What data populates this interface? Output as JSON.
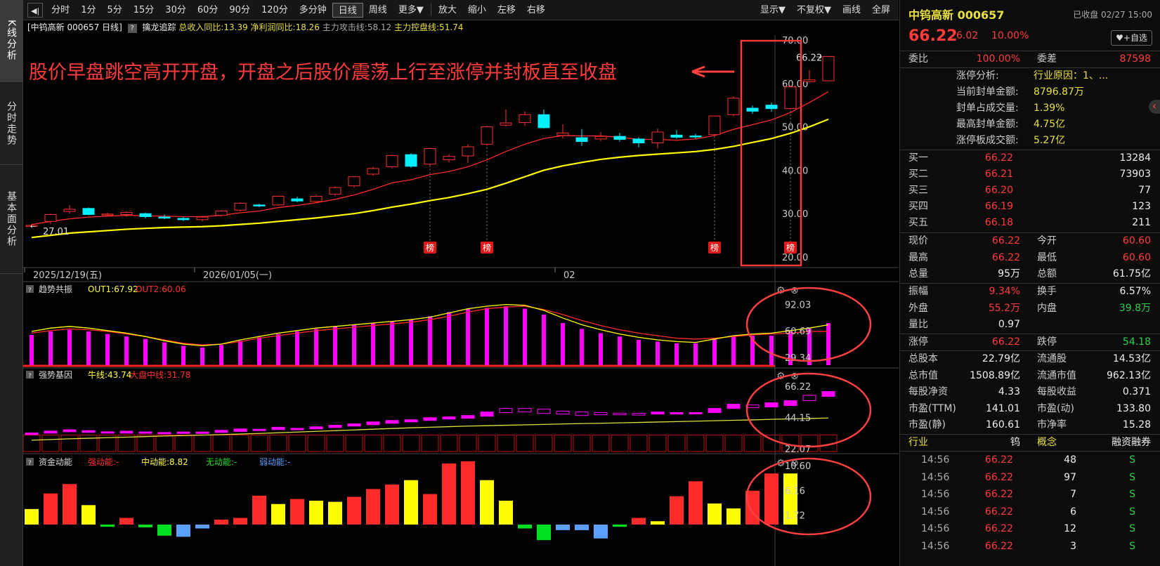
{
  "sidebar": {
    "tabs": [
      {
        "label": "K线分析"
      },
      {
        "label": "分时走势"
      },
      {
        "label": "基本面分析"
      }
    ]
  },
  "toolbar": {
    "nav_icon": "◀|",
    "periods": [
      "分时",
      "1分",
      "5分",
      "15分",
      "30分",
      "60分",
      "90分",
      "120分",
      "多分钟",
      "日线",
      "周线",
      "更多▼"
    ],
    "active": "日线",
    "actions": [
      "放大",
      "缩小",
      "左移",
      "右移"
    ],
    "right": [
      "显示▼",
      "不复权▼",
      "画线",
      "全屏"
    ]
  },
  "infobar": {
    "stock": "[中钨高新 000657 日线]",
    "indicator": "擒龙追踪",
    "v1": "总收入同比:13.39",
    "v2": "净利润同比:18.26",
    "v3": "主力攻击线:58.12",
    "v4": "主力控盘线:51.74"
  },
  "main_chart": {
    "annotation": "股价早盘跳空高开开盘，开盘之后股价震荡上行至涨停并封板直至收盘",
    "price_label": "66.22",
    "low_label": "27.01",
    "dates": [
      "2025/12/19(五)",
      "2026/01/05(一)",
      "02"
    ],
    "bang_label": "榜"
  },
  "panel2": {
    "name": "趋势共振",
    "out1": "OUT1:67.92",
    "out2": "OUT2:60.06",
    "ticks": [
      "92.03",
      "60.69",
      "29.34"
    ]
  },
  "panel3": {
    "name": "强势基因",
    "bull": "牛线:43.74",
    "market": "大盘中线:31.78",
    "ticks": [
      "66.22",
      "44.15",
      "22.07"
    ]
  },
  "panel4": {
    "name": "资金动能",
    "strong": "强动能:-",
    "mid": "中动能:8.82",
    "none": "无动能:-",
    "weak": "弱动能:-",
    "ticks": [
      "10.60",
      "6.16",
      "1.72"
    ]
  },
  "chart_data": {
    "type": "candlestick",
    "ylim": [
      20,
      70
    ],
    "yticks": [
      "70.00",
      "60.00",
      "50.00",
      "40.00",
      "30.00",
      "20.00"
    ],
    "ohlc": [
      [
        27.1,
        27.5,
        26.9,
        27.3
      ],
      [
        28.2,
        30.0,
        27.6,
        29.8
      ],
      [
        30.5,
        32.0,
        30.0,
        31.0
      ],
      [
        31.2,
        31.4,
        29.6,
        29.8
      ],
      [
        29.9,
        30.2,
        29.4,
        29.9
      ],
      [
        29.8,
        30.6,
        29.3,
        30.3
      ],
      [
        30.0,
        30.2,
        28.9,
        29.3
      ],
      [
        29.2,
        29.8,
        28.7,
        29.0
      ],
      [
        28.9,
        29.2,
        28.3,
        28.6
      ],
      [
        28.6,
        29.5,
        28.2,
        29.2
      ],
      [
        29.6,
        30.8,
        29.3,
        30.6
      ],
      [
        30.8,
        32.6,
        30.5,
        32.4
      ],
      [
        32.0,
        32.3,
        31.5,
        31.8
      ],
      [
        32.0,
        34.2,
        31.8,
        34.0
      ],
      [
        33.4,
        33.9,
        32.6,
        32.9
      ],
      [
        32.8,
        34.4,
        32.4,
        34.0
      ],
      [
        34.5,
        36.3,
        34.0,
        36.0
      ],
      [
        36.4,
        38.6,
        36.0,
        38.5
      ],
      [
        39.1,
        40.8,
        38.7,
        40.4
      ],
      [
        40.8,
        43.6,
        40.4,
        43.4
      ],
      [
        43.6,
        43.9,
        40.6,
        40.9
      ],
      [
        41.4,
        45.2,
        41.1,
        45.0
      ],
      [
        42.4,
        43.7,
        41.8,
        43.2
      ],
      [
        43.3,
        46.0,
        41.7,
        45.4
      ],
      [
        46.0,
        50.3,
        45.6,
        50.0
      ],
      [
        50.4,
        54.0,
        50.1,
        50.9
      ],
      [
        51.0,
        53.6,
        50.2,
        52.8
      ],
      [
        52.8,
        54.0,
        49.6,
        49.8
      ],
      [
        48.0,
        50.6,
        47.3,
        48.6
      ],
      [
        47.5,
        49.5,
        45.6,
        46.6
      ],
      [
        47.2,
        48.8,
        46.7,
        47.8
      ],
      [
        47.8,
        48.6,
        46.6,
        47.1
      ],
      [
        47.2,
        47.6,
        45.3,
        46.3
      ],
      [
        46.3,
        49.6,
        45.0,
        48.8
      ],
      [
        48.1,
        49.2,
        47.2,
        47.6
      ],
      [
        47.9,
        48.4,
        47.2,
        47.7
      ],
      [
        48.2,
        52.6,
        48.0,
        52.5
      ],
      [
        52.8,
        57.0,
        52.4,
        56.6
      ],
      [
        54.3,
        54.9,
        53.0,
        53.6
      ],
      [
        55.0,
        55.6,
        53.5,
        54.2
      ],
      [
        54.2,
        59.5,
        54.0,
        59.2
      ],
      [
        60.4,
        63.1,
        60.2,
        60.8
      ],
      [
        60.6,
        66.22,
        60.6,
        66.22
      ]
    ],
    "ma_red": [
      27.5,
      28.2,
      28.8,
      29.2,
      29.4,
      29.6,
      29.5,
      29.4,
      29.3,
      29.3,
      29.6,
      30.2,
      30.6,
      31.4,
      31.9,
      32.5,
      33.3,
      34.3,
      35.6,
      37.1,
      37.8,
      39.0,
      39.7,
      40.8,
      42.4,
      44.3,
      46.0,
      47.3,
      48.0,
      47.9,
      47.9,
      47.6,
      47.1,
      47.1,
      46.9,
      47.2,
      48.0,
      49.4,
      50.5,
      51.6,
      53.3,
      55.6,
      58.1
    ],
    "ma_yellow": [
      24.5,
      25.0,
      25.5,
      25.8,
      26.1,
      26.4,
      26.6,
      26.8,
      26.9,
      27.0,
      27.2,
      27.5,
      27.8,
      28.2,
      28.6,
      29.0,
      29.5,
      30.0,
      30.7,
      31.5,
      32.2,
      33.0,
      33.7,
      34.6,
      35.6,
      37.0,
      38.5,
      40.0,
      41.0,
      41.8,
      42.5,
      43.0,
      43.4,
      43.7,
      44.0,
      44.3,
      44.8,
      45.5,
      46.4,
      47.3,
      48.5,
      50.0,
      51.74
    ],
    "bang_idx": [
      21,
      24,
      36,
      40
    ],
    "trend_out1": [
      60,
      64,
      66,
      64,
      61,
      58,
      54,
      49,
      45,
      43,
      45,
      50,
      54,
      58,
      61,
      64,
      66,
      68,
      70,
      72,
      74,
      77,
      82,
      87,
      90,
      92,
      91,
      85,
      76,
      68,
      62,
      57,
      53,
      50,
      48,
      47,
      51,
      55,
      57,
      58,
      61,
      64,
      67.92
    ],
    "trend_out2": [
      58,
      61,
      63,
      62,
      60,
      57,
      54,
      50,
      46,
      44,
      45,
      48,
      52,
      55,
      58,
      61,
      63,
      65,
      67,
      69,
      71,
      74,
      78,
      83,
      87,
      89,
      90,
      86,
      80,
      73,
      67,
      62,
      58,
      55,
      52,
      51,
      52,
      54,
      56,
      57,
      58,
      60,
      60.06
    ],
    "trend_bars": [
      56,
      60,
      62,
      60,
      57,
      54,
      51,
      47,
      43,
      41,
      44,
      49,
      53,
      57,
      60,
      63,
      66,
      68,
      70,
      72,
      74,
      78,
      83,
      87,
      88,
      90,
      87,
      80,
      70,
      63,
      58,
      54,
      50,
      48,
      46,
      46,
      51,
      55,
      55,
      55,
      60,
      63,
      70
    ],
    "gene_bull": [
      28,
      28.5,
      29,
      29.4,
      29.8,
      30.2,
      30.6,
      31,
      31.3,
      31.6,
      32,
      32.4,
      32.8,
      33.3,
      33.8,
      34.3,
      34.8,
      35.3,
      35.8,
      36.3,
      36.8,
      37.2,
      37.6,
      38,
      38.3,
      38.6,
      38.9,
      39.2,
      39.5,
      39.8,
      40,
      40.3,
      40.6,
      40.9,
      41.2,
      41.5,
      41.8,
      42.1,
      42.4,
      42.8,
      43.1,
      43.4,
      43.74
    ],
    "gene_market": [
      31.7,
      31.7,
      31.7,
      31.7,
      31.7,
      31.7,
      31.7,
      31.7,
      31.7,
      31.7,
      31.7,
      31.7,
      31.7,
      31.7,
      31.7,
      31.7,
      31.7,
      31.7,
      31.7,
      31.7,
      31.7,
      31.7,
      31.7,
      31.7,
      31.7,
      31.7,
      31.7,
      31.7,
      31.7,
      31.7,
      31.7,
      31.7,
      31.7,
      31.7,
      31.7,
      31.7,
      31.7,
      31.7,
      31.7,
      31.7,
      31.7,
      31.7,
      31.78
    ],
    "gene_boxes": [
      [
        32,
        33.2
      ],
      [
        33,
        34.5
      ],
      [
        34,
        35.4
      ],
      [
        33.5,
        34.8
      ],
      [
        33,
        34
      ],
      [
        33,
        34.4
      ],
      [
        33.2,
        33.9
      ],
      [
        32.8,
        33.5
      ],
      [
        33,
        33.8
      ],
      [
        33,
        33.8
      ],
      [
        33.5,
        35
      ],
      [
        34.2,
        36
      ],
      [
        35,
        35.8
      ],
      [
        35.5,
        37.2
      ],
      [
        35.8,
        36.4
      ],
      [
        36,
        37.5
      ],
      [
        37,
        38.6
      ],
      [
        38,
        39.6
      ],
      [
        39,
        41
      ],
      [
        40,
        42
      ],
      [
        41,
        42.5
      ],
      [
        42,
        44
      ],
      [
        43,
        44.5
      ],
      [
        43.5,
        45.5
      ],
      [
        45,
        48
      ],
      [
        47.5,
        50.5
      ],
      [
        48,
        50.5
      ],
      [
        47,
        50
      ],
      [
        46.5,
        48.6
      ],
      [
        45.5,
        48
      ],
      [
        46,
        47.6
      ],
      [
        46,
        47.2
      ],
      [
        45.8,
        47
      ],
      [
        46.5,
        48
      ],
      [
        46.5,
        47.6
      ],
      [
        46.8,
        47.6
      ],
      [
        47.5,
        50.5
      ],
      [
        50.5,
        53.5
      ],
      [
        51,
        53
      ],
      [
        51.5,
        54.5
      ],
      [
        52.5,
        56
      ],
      [
        56,
        59.8
      ],
      [
        59,
        62.5
      ]
    ],
    "gene_hollow": [
      false,
      false,
      false,
      false,
      false,
      false,
      false,
      false,
      false,
      false,
      false,
      false,
      false,
      false,
      false,
      false,
      false,
      false,
      false,
      false,
      false,
      false,
      false,
      false,
      false,
      true,
      true,
      true,
      true,
      true,
      true,
      true,
      true,
      false,
      false,
      false,
      false,
      false,
      true,
      false,
      false,
      true,
      false
    ],
    "fund_values": [
      2.8,
      5.6,
      7.3,
      3.5,
      -0.4,
      1.2,
      -0.5,
      -2.0,
      -2.2,
      -0.7,
      0.9,
      1.2,
      5.2,
      3.7,
      4.6,
      4.3,
      4.1,
      5.0,
      6.4,
      7.2,
      8.0,
      5.5,
      11.0,
      11.4,
      8.0,
      4.3,
      -0.7,
      -2.8,
      -1.0,
      -1.0,
      -2.5,
      -0.4,
      1.2,
      0.6,
      5.1,
      7.8,
      3.8,
      2.9,
      6.1,
      9.2,
      9.2
    ],
    "fund_colors": [
      "yellow",
      "red",
      "red",
      "yellow",
      "green",
      "red",
      "green",
      "green",
      "blue",
      "blue",
      "red",
      "red",
      "red",
      "yellow",
      "red",
      "yellow",
      "yellow",
      "red",
      "red",
      "red",
      "yellow",
      "red",
      "red",
      "red",
      "yellow",
      "yellow",
      "green",
      "green",
      "blue",
      "blue",
      "blue",
      "green",
      "red",
      "yellow",
      "red",
      "red",
      "yellow",
      "yellow",
      "red",
      "red",
      "yellow"
    ]
  },
  "quote": {
    "name": "中钨高新 000657",
    "status": "已收盘 02/27 15:00",
    "price": "66.22",
    "change": "6.02",
    "pct": "10.00%",
    "fav_button": "♥+自选",
    "weibi_label": "委比",
    "weibi": "100.00%",
    "weicha_label": "委差",
    "weicha": "87598",
    "limit_info": [
      {
        "l": "涨停分析:",
        "v": "行业原因：1、..."
      },
      {
        "l": "当前封单金额:",
        "v": "8796.87万"
      },
      {
        "l": "封单占成交量:",
        "v": "1.39%"
      },
      {
        "l": "最高封单金额:",
        "v": "4.75亿"
      },
      {
        "l": "涨停板成交额:",
        "v": "5.27亿"
      }
    ],
    "bids": [
      {
        "l": "买一",
        "p": "66.22",
        "v": "13284"
      },
      {
        "l": "买二",
        "p": "66.21",
        "v": "73903"
      },
      {
        "l": "买三",
        "p": "66.20",
        "v": "77"
      },
      {
        "l": "买四",
        "p": "66.19",
        "v": "123"
      },
      {
        "l": "买五",
        "p": "66.18",
        "v": "211"
      }
    ],
    "stats1": [
      {
        "l1": "现价",
        "v1": "66.22",
        "c1": "red",
        "l2": "今开",
        "v2": "60.60",
        "c2": "red"
      },
      {
        "l1": "最高",
        "v1": "66.22",
        "c1": "red",
        "l2": "最低",
        "v2": "60.60",
        "c2": "red"
      },
      {
        "l1": "总量",
        "v1": "95万",
        "c1": "white",
        "l2": "总额",
        "v2": "61.75亿",
        "c2": "white"
      }
    ],
    "stats2": [
      {
        "l1": "振幅",
        "v1": "9.34%",
        "c1": "red",
        "l2": "换手",
        "v2": "6.57%",
        "c2": "white"
      },
      {
        "l1": "外盘",
        "v1": "55.2万",
        "c1": "red",
        "l2": "内盘",
        "v2": "39.8万",
        "c2": "green"
      },
      {
        "l1": "量比",
        "v1": "0.97",
        "c1": "white",
        "l2": "",
        "v2": "",
        "c2": "white"
      }
    ],
    "stats3": [
      {
        "l1": "涨停",
        "v1": "66.22",
        "c1": "red",
        "l2": "跌停",
        "v2": "54.18",
        "c2": "green"
      }
    ],
    "stats4": [
      {
        "l1": "总股本",
        "v1": "22.79亿",
        "c1": "white",
        "l2": "流通股",
        "v2": "14.53亿",
        "c2": "white"
      },
      {
        "l1": "总市值",
        "v1": "1508.89亿",
        "c1": "white",
        "l2": "流通市值",
        "v2": "962.13亿",
        "c2": "white"
      },
      {
        "l1": "每股净资",
        "v1": "4.33",
        "c1": "white",
        "l2": "每股收益",
        "v2": "0.371",
        "c2": "white"
      },
      {
        "l1": "市盈(TTM)",
        "v1": "141.01",
        "c1": "white",
        "l2": "市盈(动)",
        "v2": "133.80",
        "c2": "white"
      },
      {
        "l1": "市盈(静)",
        "v1": "160.61",
        "c1": "white",
        "l2": "市净率",
        "v2": "15.28",
        "c2": "white"
      }
    ],
    "tabs": [
      {
        "label": "行业",
        "v": "钨"
      },
      {
        "label": "概念"
      },
      {
        "label": "融资融券"
      }
    ],
    "ticks": [
      {
        "t": "14:56",
        "p": "66.22",
        "v": "48",
        "s": "S"
      },
      {
        "t": "14:56",
        "p": "66.22",
        "v": "97",
        "s": "S"
      },
      {
        "t": "14:56",
        "p": "66.22",
        "v": "7",
        "s": "S"
      },
      {
        "t": "14:56",
        "p": "66.22",
        "v": "6",
        "s": "S"
      },
      {
        "t": "14:56",
        "p": "66.22",
        "v": "12",
        "s": "S"
      },
      {
        "t": "14:56",
        "p": "66.22",
        "v": "3",
        "s": "S"
      }
    ]
  }
}
